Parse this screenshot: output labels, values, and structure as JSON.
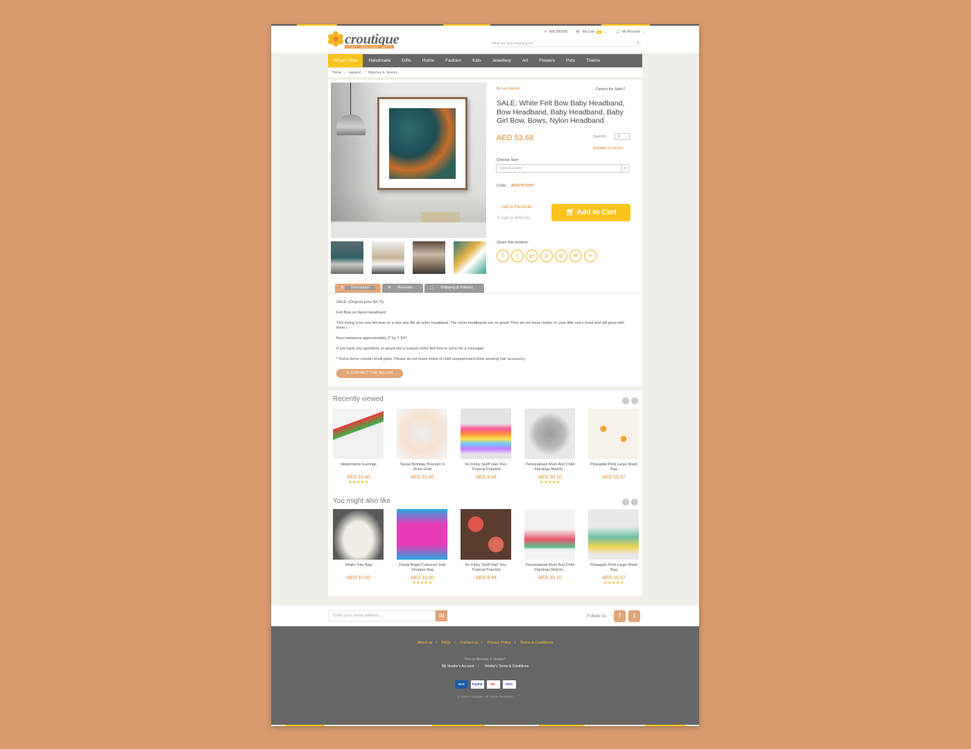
{
  "header": {
    "logo_name": "croutique",
    "logo_tagline": "CRAFT · BOUTIQUE · GIFTS",
    "phone": "800 000000",
    "cart_label": "My Cart",
    "cart_count": "0",
    "account_label": "My Account",
    "search_placeholder": "What are you shopping for?"
  },
  "nav": {
    "items": [
      "What's New",
      "Handmade",
      "Gifts",
      "Home",
      "Fashion",
      "Kids",
      "Jewellery",
      "Art",
      "Flowers",
      "Pets",
      "Theme"
    ],
    "active_index": 0
  },
  "breadcrumb": [
    "Home",
    "Apparel",
    "Watches & Jewelry"
  ],
  "product": {
    "by_prefix": "By",
    "seller": "Lee Raman",
    "contact_seller_link": "Contact the Seller?",
    "title": "SALE: White Felt Bow Baby Headband, Bow Headband, Baby Headband, Baby Girl Bow, Bows, Nylon Headband",
    "price": "AED 53.68",
    "quantity_label": "Quantity:",
    "quantity_value": "1",
    "available": "Available 10 item(s)",
    "size_label": "Choose Size:",
    "size_placeholder": "Choose a size",
    "code_label": "Code:",
    "code_value": "A0127P1V0T",
    "add_favourite": "Add to Favourite",
    "add_wishlist": "Add to Wish list",
    "add_to_cart": "Add to Cart",
    "share_label": "Share this product:",
    "share_icons": [
      "facebook-icon",
      "twitter-icon",
      "google-plus-icon",
      "pinterest-icon",
      "instagram-icon",
      "email-icon",
      "plus-icon"
    ]
  },
  "tabs": [
    "Description",
    "Reviews",
    "Shipping & Policies"
  ],
  "description": [
    "SALE! (Original price $4.75)",
    "Felt Bow on Nylon Headband",
    "This listing is for one felt bow on a one size fits all nylon headband. The nylon headbands are so great! They do not leave marks on your little one's head and will grow with them:)",
    "Bow measures approximately 3\" by 1 3/4\".",
    "If you have any questions or would like a custom order feel free to send me a message!",
    "* Some items contain small parts. Please do not leave infant of child unsupervised while wearing hair accessory."
  ],
  "contact_button": "CONTACT THE SELLER",
  "recently_viewed": {
    "title": "Recently viewed",
    "items": [
      {
        "name": "Watermelon Earrings",
        "price": "AED 10.60",
        "stars": "★★★★★"
      },
      {
        "name": "Tassel Birthday Bracelet In Rose Gold",
        "price": "AED 10.60",
        "stars": ""
      },
      {
        "name": "No Kinky Stuff! Hair Ties, Tropical Popsicle",
        "price": "AED 9.94",
        "stars": ""
      },
      {
        "name": "Personalised Mum And Child Flamingo Matchi...",
        "price": "AED 39.10",
        "stars": "★★★★★"
      },
      {
        "name": "Pineapple Print Large Wash Bag",
        "price": "AED 16.57",
        "stars": ""
      }
    ]
  },
  "also_like": {
    "title": "You might also like",
    "items": [
      {
        "name": "Mojito Tote Bag",
        "price": "AED 10.60",
        "stars": ""
      },
      {
        "name": "Fiesta Bright Coloured Jelly Shopper Bag",
        "price": "AED 10.60",
        "stars": "★★★★★"
      },
      {
        "name": "No Kinky Stuff! Hair Ties, Tropical Popsicle",
        "price": "AED 9.94",
        "stars": ""
      },
      {
        "name": "Personalised Mum And Child Flamingo Matchi...",
        "price": "AED 39.10",
        "stars": ""
      },
      {
        "name": "Pineapple Print Large Wash Bag",
        "price": "AED 16.57",
        "stars": "★★★★★"
      }
    ]
  },
  "newsletter": {
    "placeholder": "Enter your email address...",
    "follow_label": "Follow us:"
  },
  "footer": {
    "links": [
      "About us",
      "FAQs",
      "Contact us",
      "Privacy Policy",
      "Terms & Conditions"
    ],
    "vendor_prompt": "How to Become A Vendor?",
    "vendor_links": [
      "My Vendor's Account",
      "Vendor's Terms & Conditions"
    ],
    "payments": [
      "2CO",
      "PayPal",
      "MC",
      "VISA"
    ],
    "copyright": "© 2016 Croutique - All Rights Reserved"
  },
  "colors": {
    "accent_yellow": "#f8c51c",
    "accent_orange": "#e08a2c",
    "nav_gray": "#666666",
    "tab_peach": "#e2a678"
  }
}
